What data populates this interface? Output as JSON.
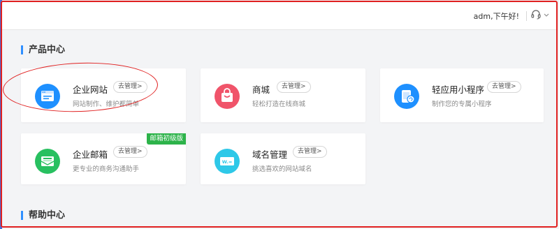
{
  "header": {
    "greeting": "adm,下午好!",
    "support_icon": "headset-icon",
    "dropdown_icon": "chevron-down-icon"
  },
  "sections": {
    "products_title": "产品中心",
    "help_title": "帮助中心"
  },
  "manage_label": "去管理>",
  "products": [
    {
      "name": "企业网站",
      "desc": "网站制作、维护都简单",
      "icon": "website-icon",
      "color": "#1e90ff"
    },
    {
      "name": "商城",
      "desc": "轻松打造在线商城",
      "icon": "shopping-bag-icon",
      "color": "#f0546a"
    },
    {
      "name": "轻应用小程序",
      "desc": "制作您的专属小程序",
      "icon": "mini-program-icon",
      "color": "#1e90ff"
    },
    {
      "name": "企业邮箱",
      "desc": "更专业的商务沟通助手",
      "icon": "mail-icon",
      "color": "#28c060",
      "badge": "邮箱初级版"
    },
    {
      "name": "域名管理",
      "desc": "挑选喜欢的网站域名",
      "icon": "domain-icon",
      "color": "#2ec8e8"
    }
  ],
  "colors": {
    "accent": "#2f8fff",
    "annotation": "#e02020",
    "badge": "#2db34a"
  }
}
